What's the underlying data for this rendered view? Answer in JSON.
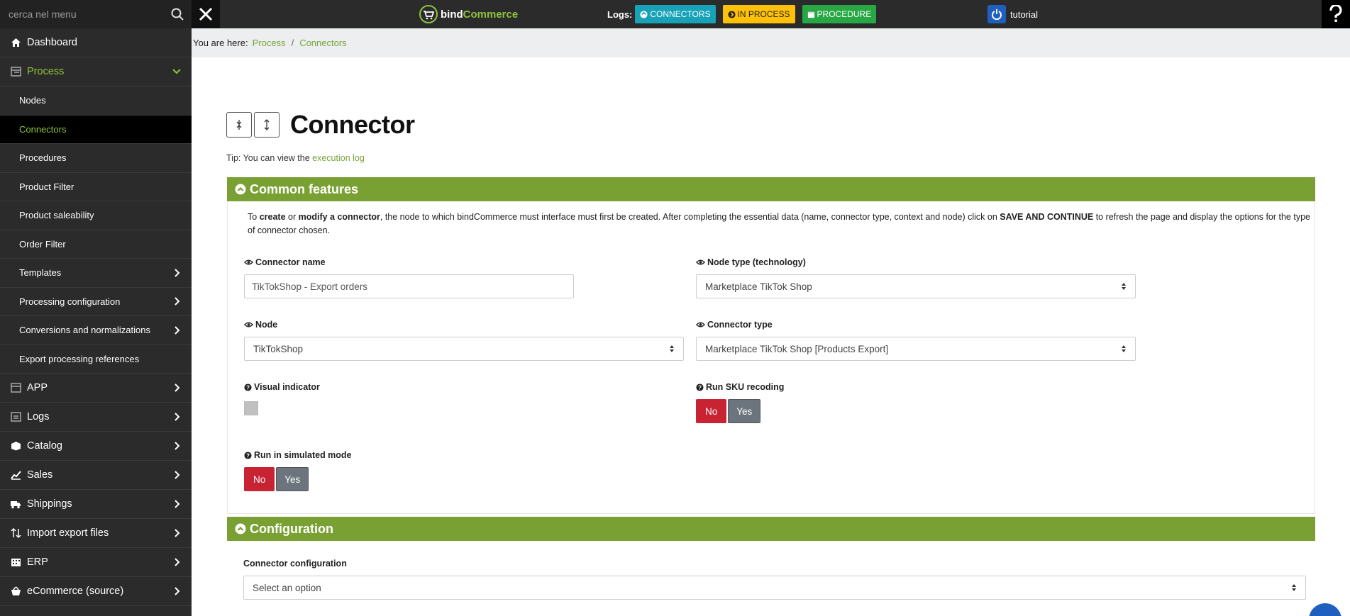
{
  "sidebar": {
    "search_placeholder": "cerca nel menu",
    "items": [
      {
        "label": "Dashboard",
        "icon": "home-icon"
      },
      {
        "label": "Process",
        "icon": "process-icon",
        "expanded": true
      },
      {
        "label": "Nodes"
      },
      {
        "label": "Connectors",
        "current": true
      },
      {
        "label": "Procedures"
      },
      {
        "label": "Product Filter"
      },
      {
        "label": "Product saleability"
      },
      {
        "label": "Order Filter"
      },
      {
        "label": "Templates"
      },
      {
        "label": "Processing configuration"
      },
      {
        "label": "Conversions and normalizations"
      },
      {
        "label": "Export processing references"
      },
      {
        "label": "APP",
        "icon": "app-icon"
      },
      {
        "label": "Logs",
        "icon": "logs-icon"
      },
      {
        "label": "Catalog",
        "icon": "box-icon"
      },
      {
        "label": "Sales",
        "icon": "chart-icon"
      },
      {
        "label": "Shippings",
        "icon": "truck-icon"
      },
      {
        "label": "Import export files",
        "icon": "sort-icon"
      },
      {
        "label": "ERP",
        "icon": "building-icon"
      },
      {
        "label": "eCommerce (source)",
        "icon": "basket-icon"
      }
    ]
  },
  "topbar": {
    "logo_prefix": "bind",
    "logo_suffix": "Commerce",
    "logs_label": "Logs:",
    "btn_connectors": "CONNECTORS",
    "btn_in_process": "IN PROCESS",
    "btn_procedure": "PROCEDURE",
    "user": "tutorial",
    "colors": {
      "connectors": "#17a2b8",
      "in_process": "#ffc107",
      "procedure": "#28a745",
      "accent": "#79a032"
    }
  },
  "breadcrumb": {
    "label": "You are here:",
    "items": [
      "Process",
      "Connectors"
    ],
    "sep": "/"
  },
  "page": {
    "title": "Connector",
    "tip_prefix": "Tip: You can view the",
    "tip_link": "execution log"
  },
  "common": {
    "header": "Common features",
    "intro": {
      "p1": "To ",
      "b1": "create",
      "p2": " or ",
      "b2": "modify a connector",
      "p3": ", the node to which bindCommerce must interface must first be created. After completing the essential data (name, connector type, context and node) click on ",
      "b3": "SAVE AND CONTINUE",
      "p4": " to refresh the page and display the options for the type of connector chosen."
    },
    "connector_name_label": "Connector name",
    "connector_name_value": "TikTokShop - Export orders",
    "node_type_label": "Node type (technology)",
    "node_type_value": "Marketplace TikTok Shop",
    "node_label": "Node",
    "node_value": "TikTokShop",
    "connector_type_label": "Connector type",
    "connector_type_value": "Marketplace TikTok Shop [Products Export]",
    "visual_indicator_label": "Visual indicator",
    "sku_label": "Run SKU recoding",
    "simulated_label": "Run in simulated mode",
    "no": "No",
    "yes": "Yes"
  },
  "configuration": {
    "header": "Configuration",
    "label": "Connector configuration",
    "placeholder": "Select an option"
  }
}
